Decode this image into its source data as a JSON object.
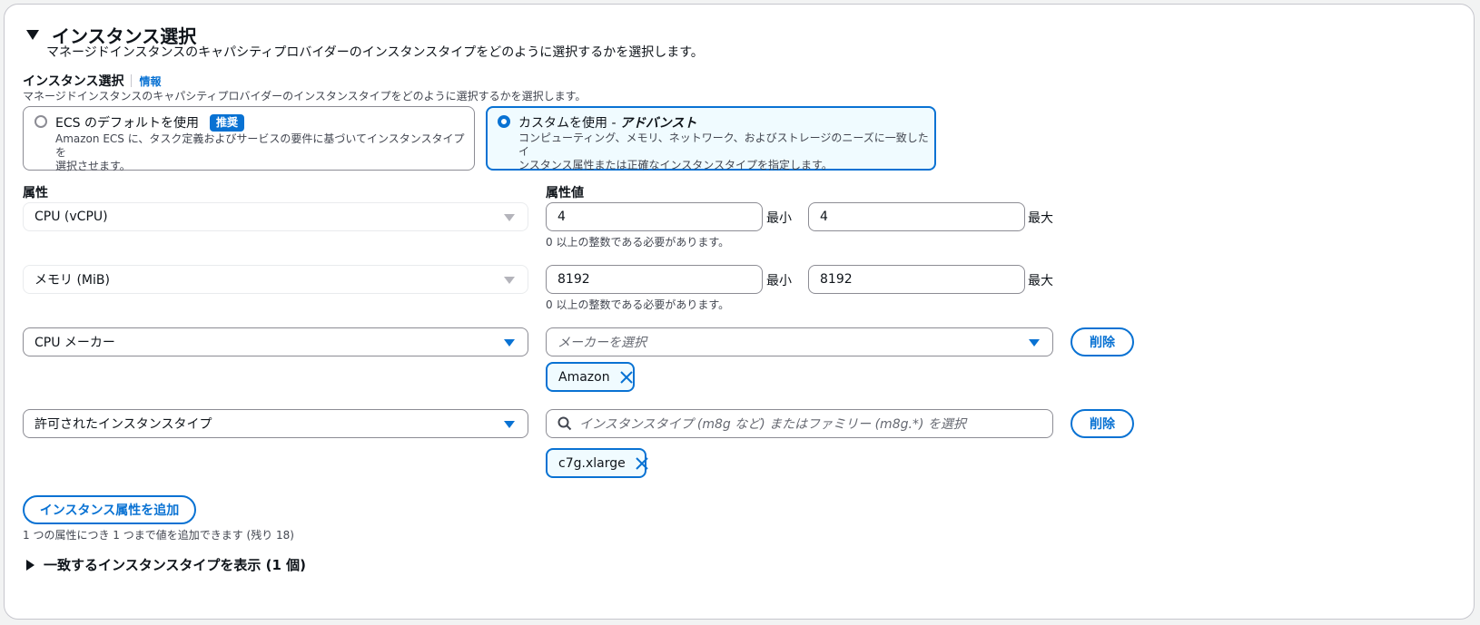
{
  "section": {
    "title": "インスタンス選択",
    "description": "マネージドインスタンスのキャパシティプロバイダーのインスタンスタイプをどのように選択するかを選択します。"
  },
  "selection": {
    "label": "インスタンス選択",
    "info_link": "情報",
    "description": "マネージドインスタンスのキャパシティプロバイダーのインスタンスタイプをどのように選択するかを選択します。",
    "options": [
      {
        "title": "ECS のデフォルトを使用",
        "badge": "推奨",
        "description_line1": "Amazon ECS に、タスク定義およびサービスの要件に基づいてインスタンスタイプを",
        "description_line2": "選択させます。",
        "selected": false
      },
      {
        "title_prefix": "カスタムを使用 - ",
        "title_emphasis": "アドバンスト",
        "description_line1": "コンピューティング、メモリ、ネットワーク、およびストレージのニーズに一致したイ",
        "description_line2": "ンスタンス属性または正確なインスタンスタイプを指定します。",
        "selected": true
      }
    ]
  },
  "attributes": {
    "attribute_header": "属性",
    "value_header": "属性値",
    "rows": [
      {
        "attribute": "CPU (vCPU)",
        "min_value": "4",
        "min_label": "最小",
        "max_value": "4",
        "max_label": "最大",
        "hint": "0 以上の整数である必要があります。"
      },
      {
        "attribute": "メモリ (MiB)",
        "min_value": "8192",
        "min_label": "最小",
        "max_value": "8192",
        "max_label": "最大",
        "hint": "0 以上の整数である必要があります。"
      },
      {
        "attribute": "CPU メーカー",
        "value_placeholder": "メーカーを選択",
        "remove_label": "削除",
        "token": "Amazon"
      },
      {
        "attribute": "許可されたインスタンスタイプ",
        "value_placeholder": "インスタンスタイプ (m8g など) またはファミリー (m8g.*) を選択",
        "remove_label": "削除",
        "token": "c7g.xlarge"
      }
    ],
    "add_button": "インスタンス属性を追加",
    "add_hint": "1 つの属性につき 1 つまで値を追加できます (残り 18)"
  },
  "matching": {
    "label": "一致するインスタンスタイプを表示 (1 個)"
  },
  "colors": {
    "accent": "#0972d3",
    "selected_bg": "#f0fbff",
    "border": "#8c8c94"
  }
}
